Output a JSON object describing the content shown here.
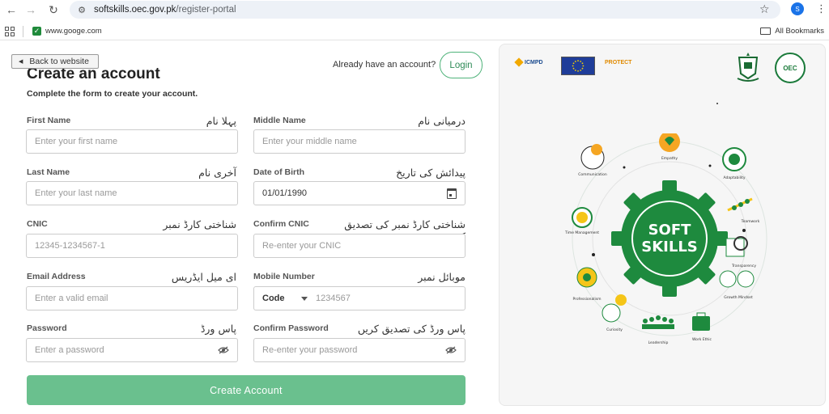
{
  "browser": {
    "url_host": "softskills.oec.gov.pk",
    "url_path": "/register-portal",
    "profile_initial": "S",
    "bookmark": "www.googe.com",
    "all_bookmarks": "All Bookmarks"
  },
  "header": {
    "back_label": "Back to website",
    "title": "Create an account",
    "subtitle": "Complete the form to create your account.",
    "already": "Already have an account?",
    "login_label": "Login"
  },
  "form": {
    "first_name": {
      "label": "First Name",
      "urdu": "پہلا نام",
      "placeholder": "Enter your first name"
    },
    "middle_name": {
      "label": "Middle Name",
      "urdu": "درمیانی نام",
      "placeholder": "Enter your middle name"
    },
    "last_name": {
      "label": "Last Name",
      "urdu": "آخری نام",
      "placeholder": "Enter your last name"
    },
    "dob": {
      "label": "Date of Birth",
      "urdu": "پیدائش کی تاریخ",
      "value": "01/01/1990"
    },
    "cnic": {
      "label": "CNIC",
      "urdu": "شناختی کارڈ نمبر",
      "placeholder": "12345-1234567-1"
    },
    "confirm_cnic": {
      "label": "Confirm CNIC",
      "urdu": "شناختی کارڈ نمبر کی تصدیق کریں",
      "placeholder": "Re-enter your CNIC"
    },
    "email": {
      "label": "Email Address",
      "urdu": "ای میل ایڈریس",
      "placeholder": "Enter a valid email"
    },
    "mobile": {
      "label": "Mobile Number",
      "urdu": "موبائل نمبر",
      "code": "Code",
      "placeholder": "1234567"
    },
    "password": {
      "label": "Password",
      "urdu": "پاس ورڈ",
      "placeholder": "Enter a password"
    },
    "confirm_password": {
      "label": "Confirm Password",
      "urdu": "پاس ورڈ کی تصدیق کریں",
      "placeholder": "Re-enter your password"
    },
    "submit_label": "Create Account"
  },
  "panel": {
    "icmpd": "ICMPD",
    "protect": "PROTECT",
    "oec": "OEC",
    "center_line1": "SOFT",
    "center_line2": "SKILLS",
    "skills": [
      "Communication",
      "Empathy",
      "Adaptability",
      "Teamwork",
      "Transparency",
      "Growth Mindset",
      "Work Ethic",
      "Leadership",
      "Curiosity",
      "Professionalism",
      "Time Management"
    ]
  },
  "colors": {
    "primary": "#2e8b57",
    "button": "#6ac08e",
    "gear": "#1e8a3e"
  }
}
